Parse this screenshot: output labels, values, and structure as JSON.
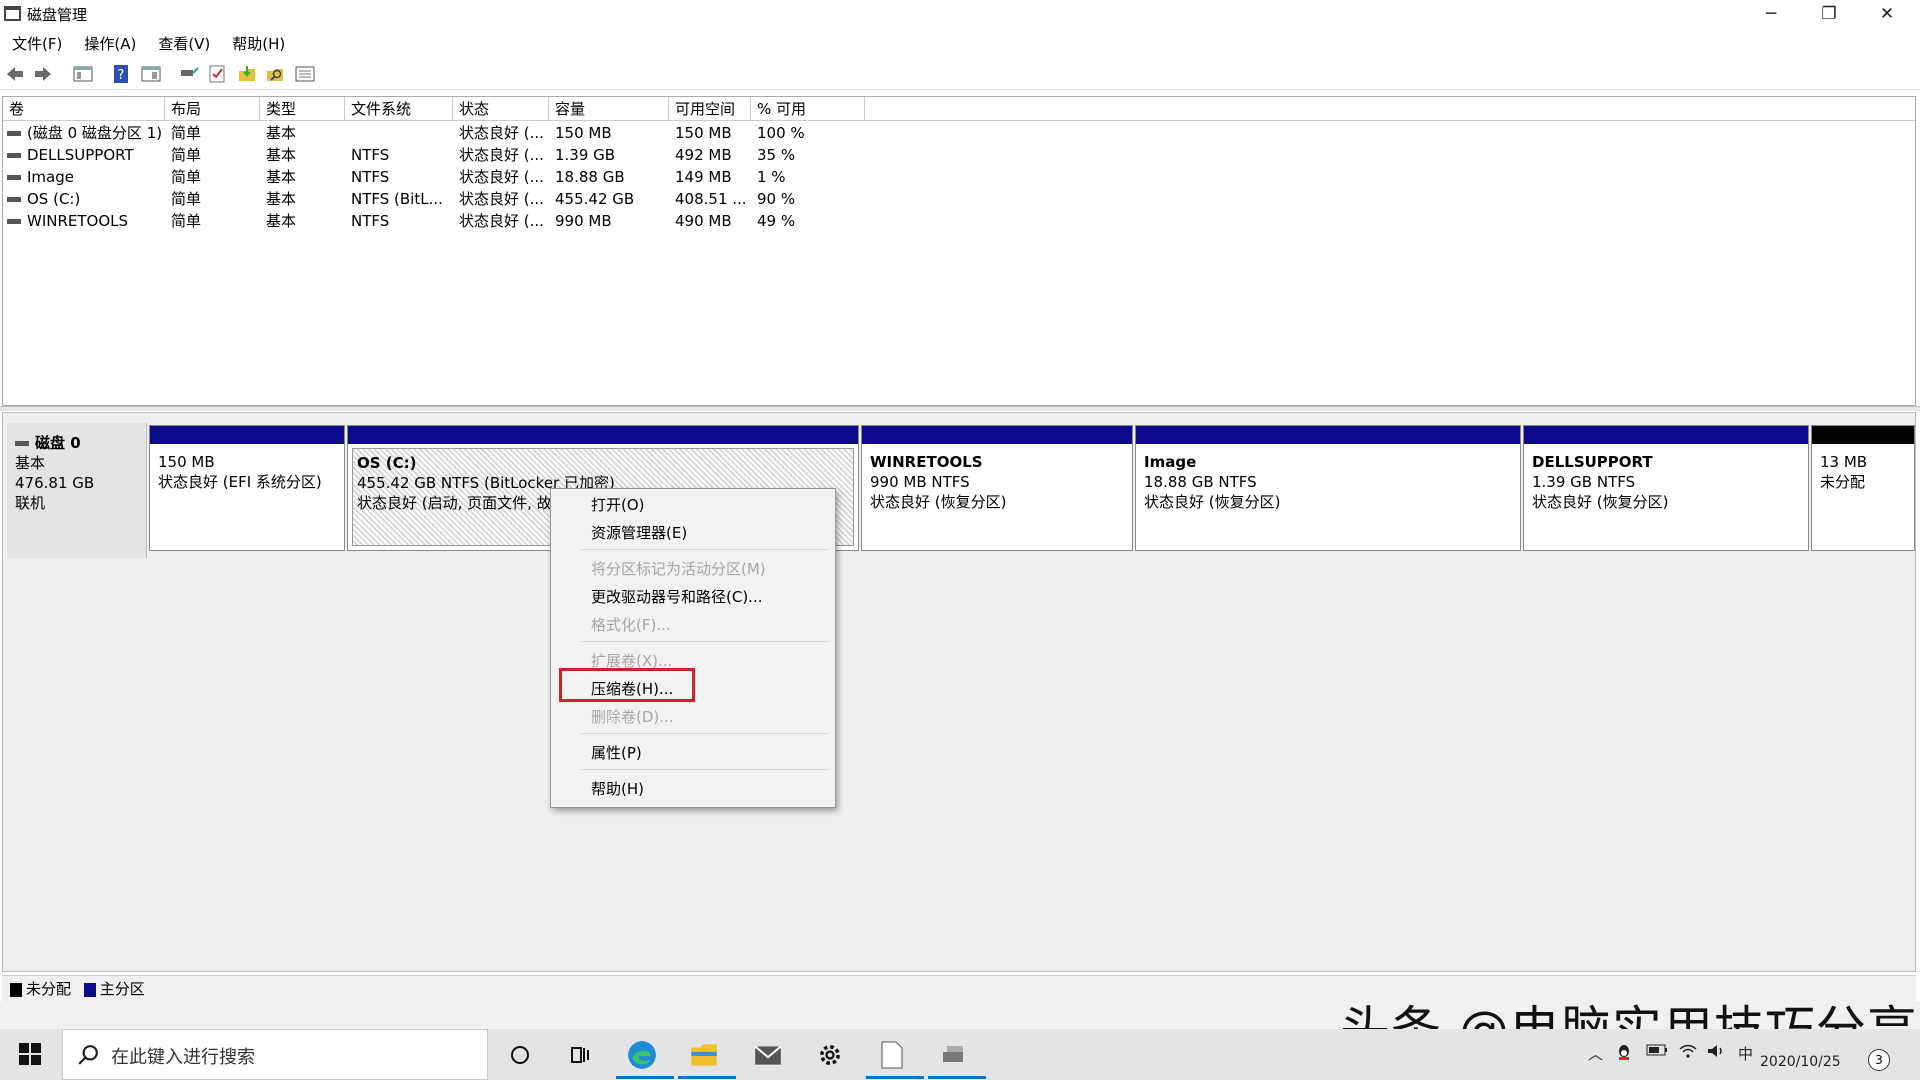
{
  "window": {
    "title": "磁盘管理"
  },
  "menubar": {
    "items": [
      "文件(F)",
      "操作(A)",
      "查看(V)",
      "帮助(H)"
    ]
  },
  "volume_list": {
    "columns": [
      "卷",
      "布局",
      "类型",
      "文件系统",
      "状态",
      "容量",
      "可用空间",
      "% 可用"
    ],
    "rows": [
      [
        "(磁盘 0 磁盘分区 1)",
        "简单",
        "基本",
        "",
        "状态良好 (...",
        "150 MB",
        "150 MB",
        "100 %"
      ],
      [
        "DELLSUPPORT",
        "简单",
        "基本",
        "NTFS",
        "状态良好 (...",
        "1.39 GB",
        "492 MB",
        "35 %"
      ],
      [
        "Image",
        "简单",
        "基本",
        "NTFS",
        "状态良好 (...",
        "18.88 GB",
        "149 MB",
        "1 %"
      ],
      [
        "OS (C:)",
        "简单",
        "基本",
        "NTFS (BitL...",
        "状态良好 (...",
        "455.42 GB",
        "408.51 ...",
        "90 %"
      ],
      [
        "WINRETOOLS",
        "简单",
        "基本",
        "NTFS",
        "状态良好 (...",
        "990 MB",
        "490 MB",
        "49 %"
      ]
    ]
  },
  "disk": {
    "name": "磁盘 0",
    "type": "基本",
    "size": "476.81 GB",
    "state": "联机",
    "partitions": [
      {
        "name": "",
        "line1": "150 MB",
        "line2": "状态良好 (EFI 系统分区)",
        "kind": "primary"
      },
      {
        "name": "OS (C:)",
        "line1": "455.42 GB NTFS (BitLocker 已加密)",
        "line2": "状态良好 (启动, 页面文件, 故障转储, 主分区)",
        "kind": "primary"
      },
      {
        "name": "WINRETOOLS",
        "line1": "990 MB NTFS",
        "line2": "状态良好 (恢复分区)",
        "kind": "primary"
      },
      {
        "name": "Image",
        "line1": "18.88 GB NTFS",
        "line2": "状态良好 (恢复分区)",
        "kind": "primary"
      },
      {
        "name": "DELLSUPPORT",
        "line1": "1.39 GB NTFS",
        "line2": "状态良好 (恢复分区)",
        "kind": "primary"
      },
      {
        "name": "",
        "line1": "13 MB",
        "line2": "未分配",
        "kind": "unallocated"
      }
    ]
  },
  "legend": {
    "unallocated": "未分配",
    "primary": "主分区",
    "unallocated_color": "#000000",
    "primary_color": "#0a0a8a"
  },
  "context_menu": {
    "items": [
      {
        "label": "打开(O)",
        "enabled": true
      },
      {
        "label": "资源管理器(E)",
        "enabled": true
      },
      {
        "label": "将分区标记为活动分区(M)",
        "enabled": false
      },
      {
        "label": "更改驱动器号和路径(C)...",
        "enabled": true
      },
      {
        "label": "格式化(F)...",
        "enabled": false
      },
      {
        "label": "扩展卷(X)...",
        "enabled": false
      },
      {
        "label": "压缩卷(H)...",
        "enabled": true,
        "highlighted": true
      },
      {
        "label": "删除卷(D)...",
        "enabled": false
      },
      {
        "label": "属性(P)",
        "enabled": true
      },
      {
        "label": "帮助(H)",
        "enabled": true
      }
    ],
    "highlight_color": "#d0202a"
  },
  "taskbar": {
    "search_placeholder": "在此键入进行搜索",
    "ime": "中",
    "date": "2020/10/25",
    "notifications": "3"
  },
  "watermark": "头条 @电脑实用技巧分享"
}
